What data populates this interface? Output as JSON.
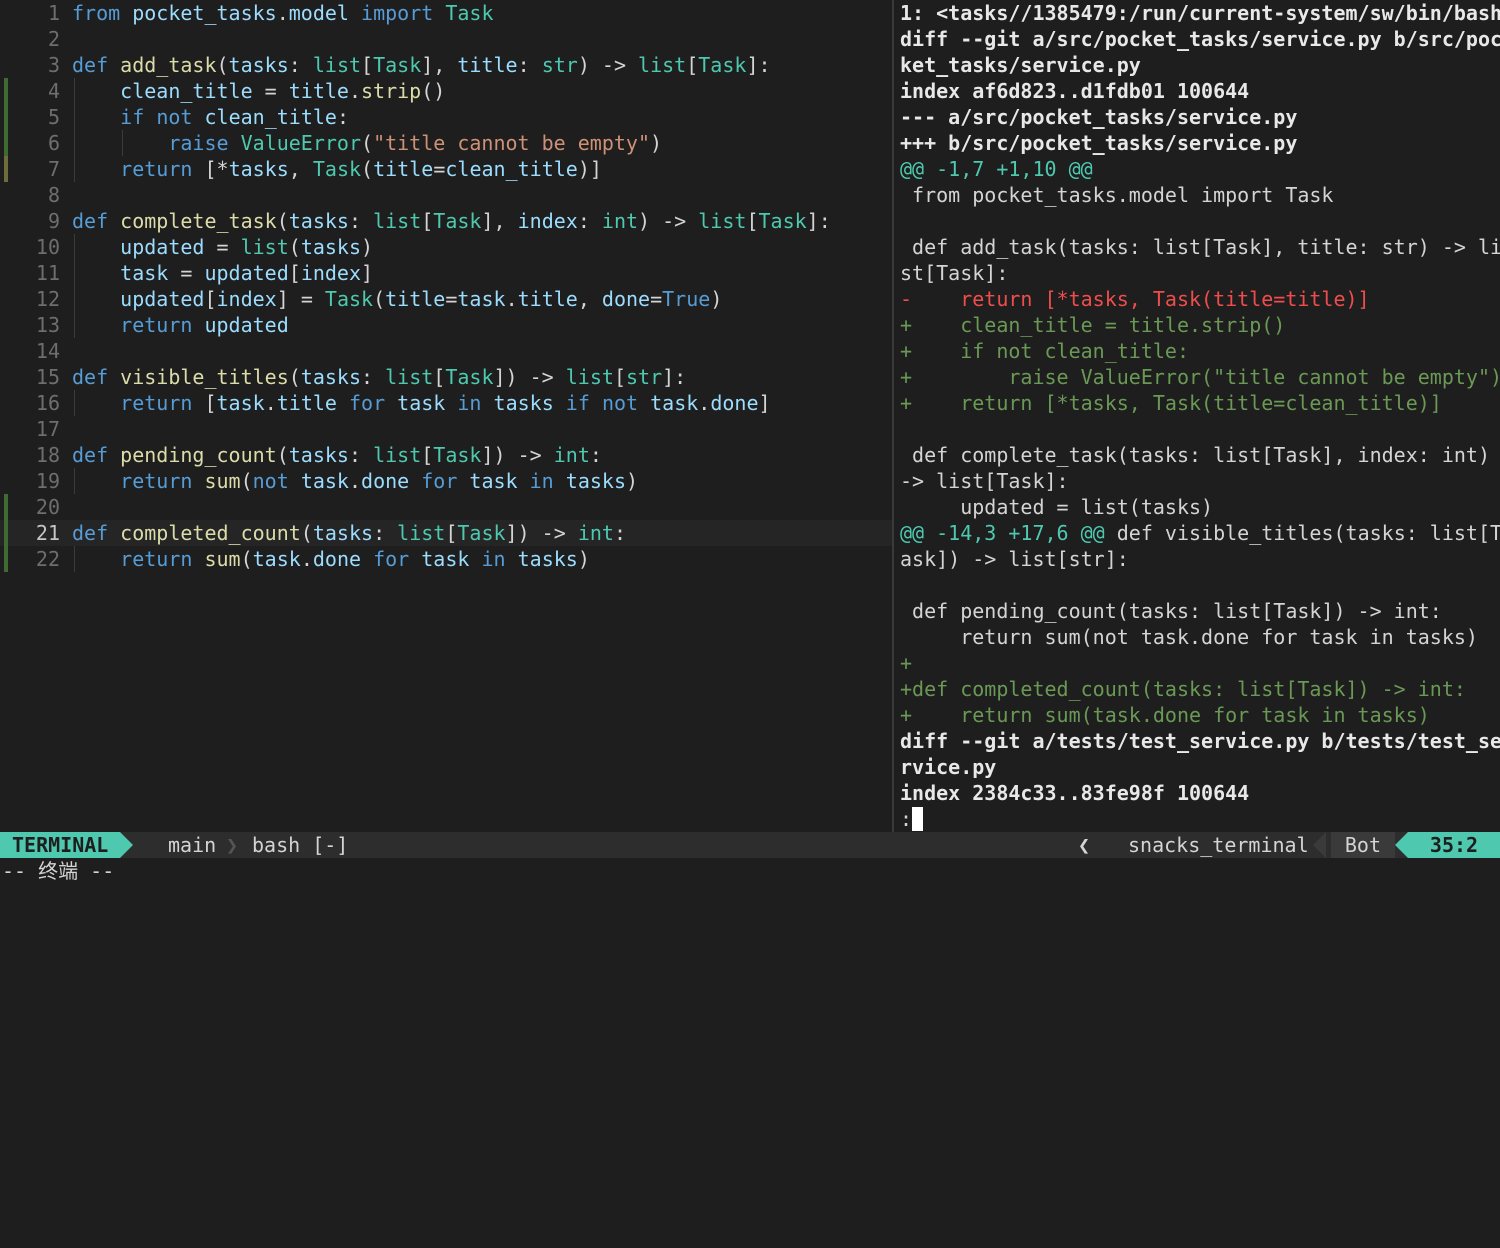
{
  "editor": {
    "lines": [
      {
        "n": "1",
        "tokens": [
          [
            "kw",
            "from"
          ],
          [
            "op",
            " "
          ],
          [
            "var",
            "pocket_tasks"
          ],
          [
            "op",
            "."
          ],
          [
            "var",
            "model"
          ],
          [
            "op",
            " "
          ],
          [
            "kw",
            "import"
          ],
          [
            "op",
            " "
          ],
          [
            "ty",
            "Task"
          ]
        ],
        "sign": "",
        "guides": 0
      },
      {
        "n": "2",
        "tokens": [],
        "sign": "",
        "guides": 0
      },
      {
        "n": "3",
        "tokens": [
          [
            "kw",
            "def"
          ],
          [
            "op",
            " "
          ],
          [
            "fn",
            "add_task"
          ],
          [
            "pn",
            "("
          ],
          [
            "var",
            "tasks"
          ],
          [
            "op",
            ": "
          ],
          [
            "ty",
            "list"
          ],
          [
            "pn",
            "["
          ],
          [
            "ty",
            "Task"
          ],
          [
            "pn",
            "]"
          ],
          [
            "op",
            ", "
          ],
          [
            "var",
            "title"
          ],
          [
            "op",
            ": "
          ],
          [
            "ty",
            "str"
          ],
          [
            "pn",
            ")"
          ],
          [
            "op",
            " -> "
          ],
          [
            "ty",
            "list"
          ],
          [
            "pn",
            "["
          ],
          [
            "ty",
            "Task"
          ],
          [
            "pn",
            "]"
          ],
          [
            "op",
            ":"
          ]
        ],
        "sign": "",
        "guides": 0
      },
      {
        "n": "4",
        "tokens": [
          [
            "op",
            "    "
          ],
          [
            "var",
            "clean_title"
          ],
          [
            "op",
            " = "
          ],
          [
            "var",
            "title"
          ],
          [
            "op",
            "."
          ],
          [
            "fn",
            "strip"
          ],
          [
            "pn",
            "()"
          ]
        ],
        "sign": "add",
        "guides": 1
      },
      {
        "n": "5",
        "tokens": [
          [
            "op",
            "    "
          ],
          [
            "kw",
            "if"
          ],
          [
            "op",
            " "
          ],
          [
            "kw",
            "not"
          ],
          [
            "op",
            " "
          ],
          [
            "var",
            "clean_title"
          ],
          [
            "op",
            ":"
          ]
        ],
        "sign": "add",
        "guides": 1
      },
      {
        "n": "6",
        "tokens": [
          [
            "op",
            "        "
          ],
          [
            "kw",
            "raise"
          ],
          [
            "op",
            " "
          ],
          [
            "ty",
            "ValueError"
          ],
          [
            "pn",
            "("
          ],
          [
            "str",
            "\"title cannot be empty\""
          ],
          [
            "pn",
            ")"
          ]
        ],
        "sign": "add",
        "guides": 2
      },
      {
        "n": "7",
        "tokens": [
          [
            "op",
            "    "
          ],
          [
            "kw",
            "return"
          ],
          [
            "op",
            " "
          ],
          [
            "pn",
            "["
          ],
          [
            "op",
            "*"
          ],
          [
            "var",
            "tasks"
          ],
          [
            "op",
            ", "
          ],
          [
            "ty",
            "Task"
          ],
          [
            "pn",
            "("
          ],
          [
            "var",
            "title"
          ],
          [
            "op",
            "="
          ],
          [
            "var",
            "clean_title"
          ],
          [
            "pn",
            ")]"
          ]
        ],
        "sign": "chg",
        "guides": 1
      },
      {
        "n": "8",
        "tokens": [],
        "sign": "",
        "guides": 0
      },
      {
        "n": "9",
        "tokens": [
          [
            "kw",
            "def"
          ],
          [
            "op",
            " "
          ],
          [
            "fn",
            "complete_task"
          ],
          [
            "pn",
            "("
          ],
          [
            "var",
            "tasks"
          ],
          [
            "op",
            ": "
          ],
          [
            "ty",
            "list"
          ],
          [
            "pn",
            "["
          ],
          [
            "ty",
            "Task"
          ],
          [
            "pn",
            "]"
          ],
          [
            "op",
            ", "
          ],
          [
            "var",
            "index"
          ],
          [
            "op",
            ": "
          ],
          [
            "ty",
            "int"
          ],
          [
            "pn",
            ")"
          ],
          [
            "op",
            " -> "
          ],
          [
            "ty",
            "list"
          ],
          [
            "pn",
            "["
          ],
          [
            "ty",
            "Task"
          ],
          [
            "pn",
            "]"
          ],
          [
            "op",
            ":"
          ]
        ],
        "sign": "",
        "guides": 0
      },
      {
        "n": "10",
        "tokens": [
          [
            "op",
            "    "
          ],
          [
            "var",
            "updated"
          ],
          [
            "op",
            " = "
          ],
          [
            "ty",
            "list"
          ],
          [
            "pn",
            "("
          ],
          [
            "var",
            "tasks"
          ],
          [
            "pn",
            ")"
          ]
        ],
        "sign": "",
        "guides": 1
      },
      {
        "n": "11",
        "tokens": [
          [
            "op",
            "    "
          ],
          [
            "var",
            "task"
          ],
          [
            "op",
            " = "
          ],
          [
            "var",
            "updated"
          ],
          [
            "pn",
            "["
          ],
          [
            "var",
            "index"
          ],
          [
            "pn",
            "]"
          ]
        ],
        "sign": "",
        "guides": 1
      },
      {
        "n": "12",
        "tokens": [
          [
            "op",
            "    "
          ],
          [
            "var",
            "updated"
          ],
          [
            "pn",
            "["
          ],
          [
            "var",
            "index"
          ],
          [
            "pn",
            "]"
          ],
          [
            "op",
            " = "
          ],
          [
            "ty",
            "Task"
          ],
          [
            "pn",
            "("
          ],
          [
            "var",
            "title"
          ],
          [
            "op",
            "="
          ],
          [
            "var",
            "task"
          ],
          [
            "op",
            "."
          ],
          [
            "var",
            "title"
          ],
          [
            "op",
            ", "
          ],
          [
            "var",
            "done"
          ],
          [
            "op",
            "="
          ],
          [
            "kw",
            "True"
          ],
          [
            "pn",
            ")"
          ]
        ],
        "sign": "",
        "guides": 1
      },
      {
        "n": "13",
        "tokens": [
          [
            "op",
            "    "
          ],
          [
            "kw",
            "return"
          ],
          [
            "op",
            " "
          ],
          [
            "var",
            "updated"
          ]
        ],
        "sign": "",
        "guides": 1
      },
      {
        "n": "14",
        "tokens": [],
        "sign": "",
        "guides": 0
      },
      {
        "n": "15",
        "tokens": [
          [
            "kw",
            "def"
          ],
          [
            "op",
            " "
          ],
          [
            "fn",
            "visible_titles"
          ],
          [
            "pn",
            "("
          ],
          [
            "var",
            "tasks"
          ],
          [
            "op",
            ": "
          ],
          [
            "ty",
            "list"
          ],
          [
            "pn",
            "["
          ],
          [
            "ty",
            "Task"
          ],
          [
            "pn",
            "])"
          ],
          [
            "op",
            " -> "
          ],
          [
            "ty",
            "list"
          ],
          [
            "pn",
            "["
          ],
          [
            "ty",
            "str"
          ],
          [
            "pn",
            "]"
          ],
          [
            "op",
            ":"
          ]
        ],
        "sign": "",
        "guides": 0
      },
      {
        "n": "16",
        "tokens": [
          [
            "op",
            "    "
          ],
          [
            "kw",
            "return"
          ],
          [
            "op",
            " "
          ],
          [
            "pn",
            "["
          ],
          [
            "var",
            "task"
          ],
          [
            "op",
            "."
          ],
          [
            "var",
            "title"
          ],
          [
            "op",
            " "
          ],
          [
            "kw",
            "for"
          ],
          [
            "op",
            " "
          ],
          [
            "var",
            "task"
          ],
          [
            "op",
            " "
          ],
          [
            "kw",
            "in"
          ],
          [
            "op",
            " "
          ],
          [
            "var",
            "tasks"
          ],
          [
            "op",
            " "
          ],
          [
            "kw",
            "if"
          ],
          [
            "op",
            " "
          ],
          [
            "kw",
            "not"
          ],
          [
            "op",
            " "
          ],
          [
            "var",
            "task"
          ],
          [
            "op",
            "."
          ],
          [
            "var",
            "done"
          ],
          [
            "pn",
            "]"
          ]
        ],
        "sign": "",
        "guides": 1
      },
      {
        "n": "17",
        "tokens": [],
        "sign": "",
        "guides": 0
      },
      {
        "n": "18",
        "tokens": [
          [
            "kw",
            "def"
          ],
          [
            "op",
            " "
          ],
          [
            "fn",
            "pending_count"
          ],
          [
            "pn",
            "("
          ],
          [
            "var",
            "tasks"
          ],
          [
            "op",
            ": "
          ],
          [
            "ty",
            "list"
          ],
          [
            "pn",
            "["
          ],
          [
            "ty",
            "Task"
          ],
          [
            "pn",
            "])"
          ],
          [
            "op",
            " -> "
          ],
          [
            "ty",
            "int"
          ],
          [
            "op",
            ":"
          ]
        ],
        "sign": "",
        "guides": 0
      },
      {
        "n": "19",
        "tokens": [
          [
            "op",
            "    "
          ],
          [
            "kw",
            "return"
          ],
          [
            "op",
            " "
          ],
          [
            "fn",
            "sum"
          ],
          [
            "pn",
            "("
          ],
          [
            "kw",
            "not"
          ],
          [
            "op",
            " "
          ],
          [
            "var",
            "task"
          ],
          [
            "op",
            "."
          ],
          [
            "var",
            "done"
          ],
          [
            "op",
            " "
          ],
          [
            "kw",
            "for"
          ],
          [
            "op",
            " "
          ],
          [
            "var",
            "task"
          ],
          [
            "op",
            " "
          ],
          [
            "kw",
            "in"
          ],
          [
            "op",
            " "
          ],
          [
            "var",
            "tasks"
          ],
          [
            "pn",
            ")"
          ]
        ],
        "sign": "",
        "guides": 1
      },
      {
        "n": "20",
        "tokens": [],
        "sign": "add",
        "guides": 0
      },
      {
        "n": "21",
        "tokens": [
          [
            "kw",
            "def"
          ],
          [
            "op",
            " "
          ],
          [
            "fn",
            "completed_count"
          ],
          [
            "pn",
            "("
          ],
          [
            "var",
            "tasks"
          ],
          [
            "op",
            ": "
          ],
          [
            "ty",
            "list"
          ],
          [
            "pn",
            "["
          ],
          [
            "ty",
            "Task"
          ],
          [
            "pn",
            "])"
          ],
          [
            "op",
            " -> "
          ],
          [
            "ty",
            "int"
          ],
          [
            "op",
            ":"
          ]
        ],
        "sign": "add",
        "guides": 0,
        "current": true
      },
      {
        "n": "22",
        "tokens": [
          [
            "op",
            "    "
          ],
          [
            "kw",
            "return"
          ],
          [
            "op",
            " "
          ],
          [
            "fn",
            "sum"
          ],
          [
            "pn",
            "("
          ],
          [
            "var",
            "task"
          ],
          [
            "op",
            "."
          ],
          [
            "var",
            "done"
          ],
          [
            "op",
            " "
          ],
          [
            "kw",
            "for"
          ],
          [
            "op",
            " "
          ],
          [
            "var",
            "task"
          ],
          [
            "op",
            " "
          ],
          [
            "kw",
            "in"
          ],
          [
            "op",
            " "
          ],
          [
            "var",
            "tasks"
          ],
          [
            "pn",
            ")"
          ]
        ],
        "sign": "add",
        "guides": 1
      }
    ]
  },
  "terminal": {
    "lines": [
      {
        "t": "1: <tasks//1385479:/run/current-system/sw/bin/bash",
        "k": "bold"
      },
      {
        "t": "diff --git a/src/pocket_tasks/service.py b/src/poc",
        "k": "bold"
      },
      {
        "t": "ket_tasks/service.py",
        "k": "bold"
      },
      {
        "t": "index af6d823..d1fdb01 100644",
        "k": "bold"
      },
      {
        "t": "--- a/src/pocket_tasks/service.py",
        "k": "bold"
      },
      {
        "t": "+++ b/src/pocket_tasks/service.py",
        "k": "bold"
      },
      {
        "t": "@@ -1,7 +1,10 @@",
        "k": "hunk",
        "ctx": ""
      },
      {
        "t": " from pocket_tasks.model import Task",
        "k": ""
      },
      {
        "t": "",
        "k": ""
      },
      {
        "t": " def add_task(tasks: list[Task], title: str) -> li",
        "k": ""
      },
      {
        "t": "st[Task]:",
        "k": ""
      },
      {
        "t": "-    return [*tasks, Task(title=title)]",
        "k": "del"
      },
      {
        "t": "+    clean_title = title.strip()",
        "k": "add"
      },
      {
        "t": "+    if not clean_title:",
        "k": "add"
      },
      {
        "t": "+        raise ValueError(\"title cannot be empty\")",
        "k": "add"
      },
      {
        "t": "+    return [*tasks, Task(title=clean_title)]",
        "k": "add"
      },
      {
        "t": "",
        "k": ""
      },
      {
        "t": " def complete_task(tasks: list[Task], index: int)",
        "k": ""
      },
      {
        "t": "-> list[Task]:",
        "k": ""
      },
      {
        "t": "     updated = list(tasks)",
        "k": ""
      },
      {
        "t": "@@ -14,3 +17,6 @@",
        "k": "hunk",
        "ctx": " def visible_titles(tasks: list[T"
      },
      {
        "t": "ask]) -> list[str]:",
        "k": ""
      },
      {
        "t": "",
        "k": ""
      },
      {
        "t": " def pending_count(tasks: list[Task]) -> int:",
        "k": ""
      },
      {
        "t": "     return sum(not task.done for task in tasks)",
        "k": ""
      },
      {
        "t": "+",
        "k": "add"
      },
      {
        "t": "+def completed_count(tasks: list[Task]) -> int:",
        "k": "add"
      },
      {
        "t": "+    return sum(task.done for task in tasks)",
        "k": "add"
      },
      {
        "t": "diff --git a/tests/test_service.py b/tests/test_se",
        "k": "bold"
      },
      {
        "t": "rvice.py",
        "k": "bold"
      },
      {
        "t": "index 2384c33..83fe98f 100644",
        "k": "bold"
      }
    ],
    "prompt": ":"
  },
  "statusline": {
    "mode": "TERMINAL",
    "branch_icon": "git-branch-icon",
    "branch": "main",
    "buffer": "bash [-]",
    "lsp_icon": "⑂",
    "ft_icon": "●",
    "filetype": "snacks_terminal",
    "scroll": "Bot",
    "position": "35:2"
  },
  "cmdline": {
    "text": "-- 终端 --"
  },
  "colors": {
    "accent": "#4ec9b0",
    "keyword": "#569cd6",
    "function": "#dcdcaa",
    "type": "#4ec9b0",
    "variable": "#9cdcfe",
    "string": "#ce9178",
    "diff_add": "#6a9955",
    "diff_del": "#f14c4c"
  }
}
